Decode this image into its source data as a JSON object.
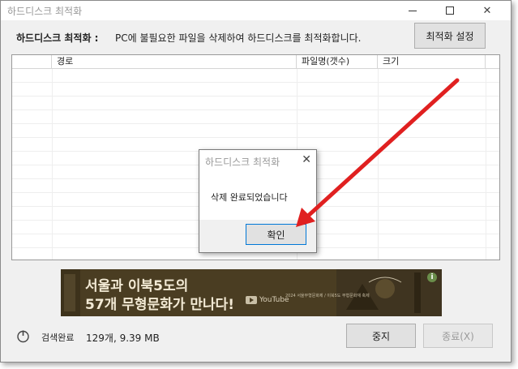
{
  "window": {
    "title": "하드디스크 최적화",
    "controls": {
      "minimize": "—",
      "maximize": "☐",
      "close": "✕"
    }
  },
  "toolbar": {
    "label": "하드디스크 최적화 :",
    "description": "PC에 불필요한 파일을 삭제하여 하드디스크를 최적화합니다.",
    "settings_button": "최적화 설정"
  },
  "list": {
    "columns": [
      "",
      "경로",
      "파일명(갯수)",
      "크기"
    ]
  },
  "ad": {
    "line1": "서울과 이북5도의",
    "line2": "57개 무형문화가 만나다!",
    "brand": "YouTube",
    "fine_print": "2024 서울무형문화제 / 이북5도 무형문화재 축제",
    "info": "i"
  },
  "status": {
    "state": "검색완료",
    "count": "129개, 9.39 MB"
  },
  "buttons": {
    "stop": "중지",
    "exit": "종료(X)"
  },
  "dialog": {
    "title": "하드디스크 최적화",
    "close": "✕",
    "message": "삭제 완료되었습니다",
    "ok": "확인"
  },
  "colors": {
    "arrow": "#e02020",
    "dialog_focus": "#0078d7",
    "ad_background": "#4a3d22"
  }
}
